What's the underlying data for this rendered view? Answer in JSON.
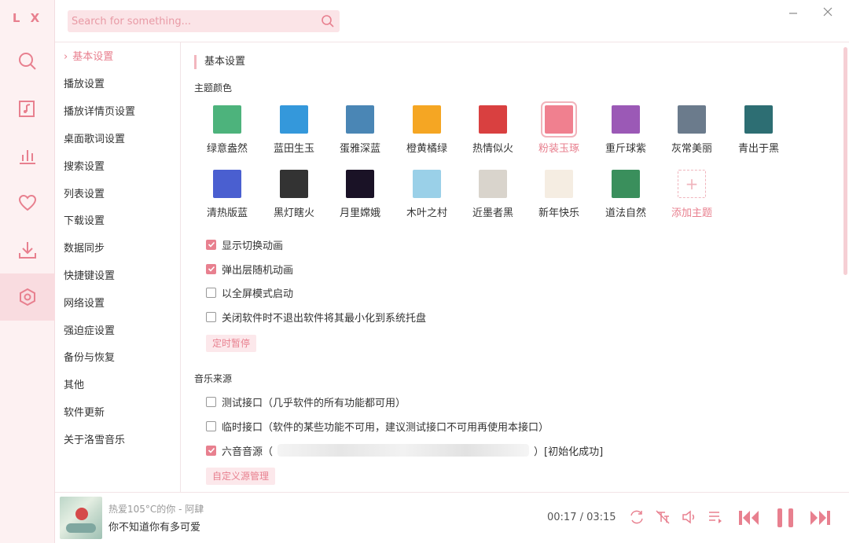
{
  "app": {
    "logo": "L X"
  },
  "search": {
    "placeholder": "Search for something..."
  },
  "rail": [
    {
      "icon": "search-icon"
    },
    {
      "icon": "music-list-icon"
    },
    {
      "icon": "chart-icon"
    },
    {
      "icon": "heart-icon"
    },
    {
      "icon": "download-icon"
    },
    {
      "icon": "settings-icon",
      "active": true
    }
  ],
  "nav": {
    "items": [
      "基本设置",
      "播放设置",
      "播放详情页设置",
      "桌面歌词设置",
      "搜索设置",
      "列表设置",
      "下载设置",
      "数据同步",
      "快捷键设置",
      "网络设置",
      "强迫症设置",
      "备份与恢复",
      "其他",
      "软件更新",
      "关于洛雪音乐"
    ]
  },
  "basic": {
    "section_title": "基本设置",
    "theme_title": "主题颜色",
    "themes": [
      {
        "name": "绿意盎然",
        "color": "#4db37c"
      },
      {
        "name": "蓝田生玉",
        "color": "#3498db"
      },
      {
        "name": "蛋雅深蓝",
        "color": "#4a86b5"
      },
      {
        "name": "橙黄橘绿",
        "color": "#f5a623"
      },
      {
        "name": "热情似火",
        "color": "#d94040"
      },
      {
        "name": "粉装玉琢",
        "color": "#f0808f"
      },
      {
        "name": "重斤球紫",
        "color": "#9b59b6"
      },
      {
        "name": "灰常美丽",
        "color": "#6b7b8c"
      },
      {
        "name": "青出于黑",
        "color": "#2d6e73"
      },
      {
        "name": "清热版蓝",
        "color": "#4a5fd0"
      },
      {
        "name": "黑灯瞎火",
        "color": "#333333"
      },
      {
        "name": "月里嫦娥",
        "color": "#1a1226"
      },
      {
        "name": "木叶之村",
        "color": "#9ad0e8"
      },
      {
        "name": "近墨者黑",
        "color": "#d9d4cc"
      },
      {
        "name": "新年快乐",
        "color": "#f5ede2"
      },
      {
        "name": "道法自然",
        "color": "#3a8f5c"
      },
      {
        "name": "添加主题",
        "color": "#ffffff"
      }
    ],
    "checks": [
      {
        "label": "显示切换动画",
        "checked": true
      },
      {
        "label": "弹出层随机动画",
        "checked": true
      },
      {
        "label": "以全屏模式启动",
        "checked": false
      },
      {
        "label": "关闭软件时不退出软件将其最小化到系统托盘",
        "checked": false
      }
    ],
    "timer_button": "定时暂停"
  },
  "source": {
    "title": "音乐来源",
    "items": [
      {
        "label": "测试接口（几乎软件的所有功能都可用）",
        "checked": false
      },
      {
        "label": "临时接口（软件的某些功能不可用，建议测试接口不可用再使用本接口）",
        "checked": false
      },
      {
        "label": "六音音源（",
        "suffix": "）[初始化成功]",
        "checked": true
      }
    ],
    "custom_button": "自定义源管理"
  },
  "player": {
    "song": "热爱105°C的你 - 阿肆",
    "lyric": "你不知道你有多可爱",
    "time": "00:17 / 03:15"
  },
  "colors": {
    "accent": "#e8808f",
    "accent_light": "#fce8eb"
  }
}
